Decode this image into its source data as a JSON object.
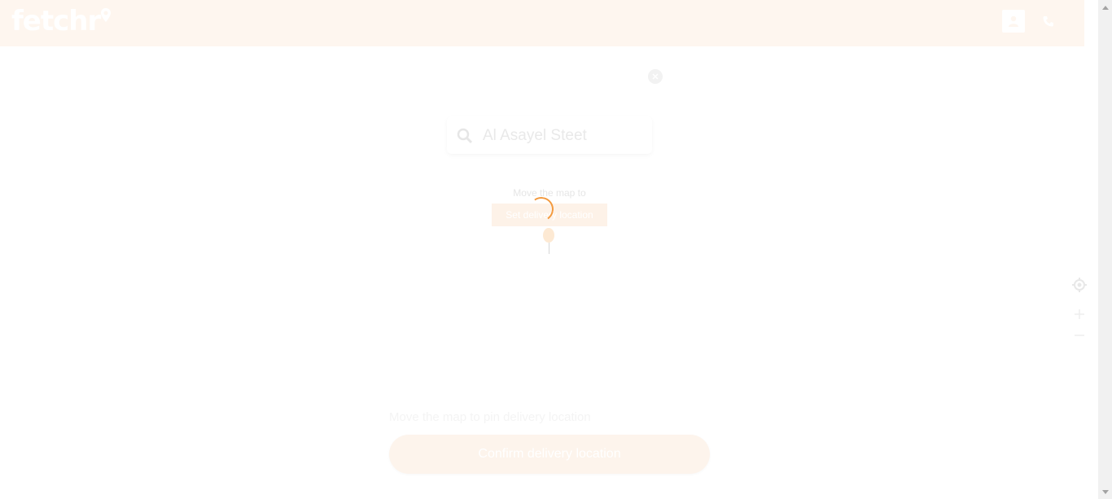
{
  "header": {
    "logo_text": "fetchr",
    "user_icon": "user-icon",
    "phone_icon": "phone-icon",
    "background": "#fef6ef"
  },
  "search": {
    "placeholder": "Al Asayel Steet",
    "icon": "search-icon"
  },
  "map_pin": {
    "hint": "Move the map to",
    "label": "Set delivery location"
  },
  "map_controls": {
    "locate_icon": "crosshair-icon",
    "zoom_in": "+",
    "zoom_out": "−"
  },
  "footer": {
    "hint": "Move the map to pin delivery location",
    "confirm_label": "Confirm delivery location"
  },
  "colors": {
    "accent": "#f39a3f",
    "button_bg": "#fdf4ec"
  }
}
